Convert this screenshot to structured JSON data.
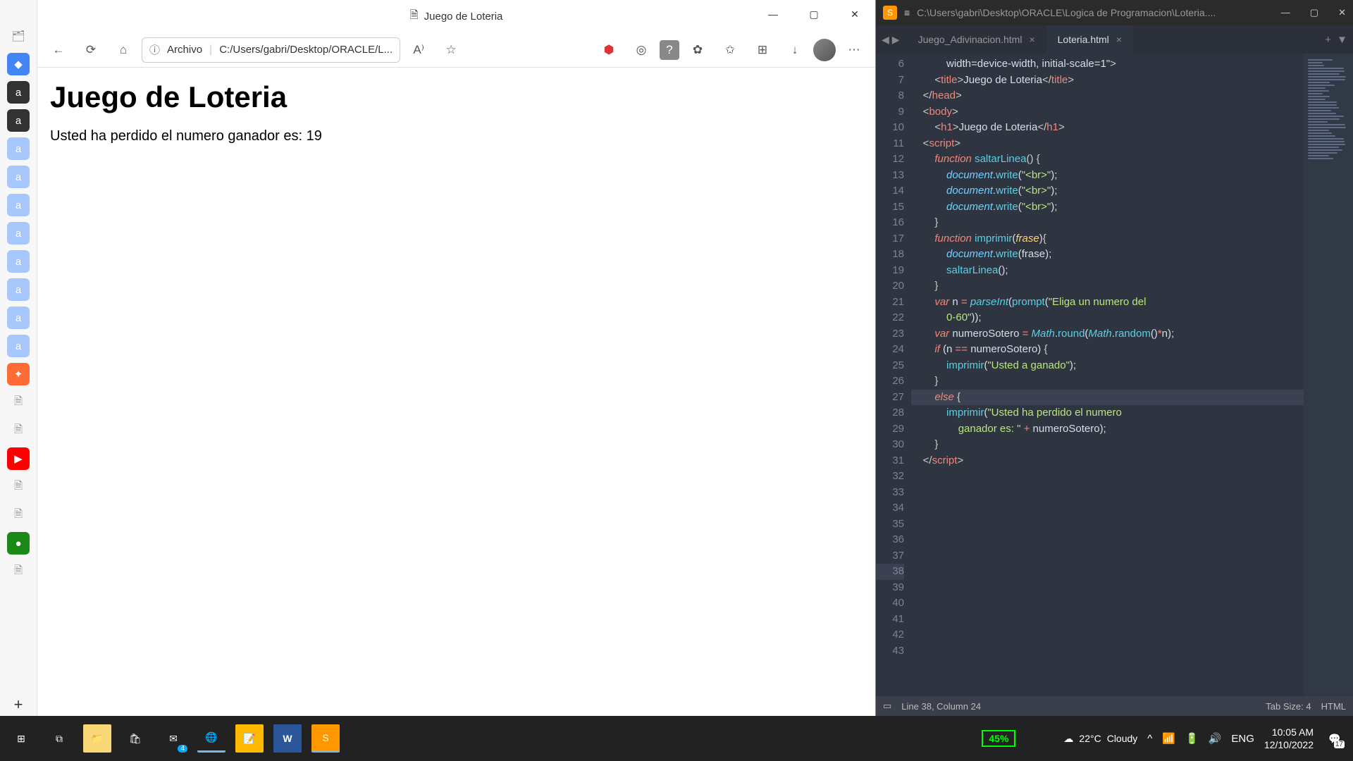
{
  "browser": {
    "title": "Juego de Loteria",
    "url_label": "Archivo",
    "url_path": "C:/Users/gabri/Desktop/ORACLE/L...",
    "page_heading": "Juego de Loteria",
    "page_text": "Usted ha perdido el numero ganador es: 19"
  },
  "sublime": {
    "title_path": "C:\\Users\\gabri\\Desktop\\ORACLE\\Logica de Programacion\\Loteria....",
    "tabs": [
      {
        "label": "Juego_Adivinacion.html",
        "active": false
      },
      {
        "label": "Loteria.html",
        "active": true
      }
    ],
    "gutter_start": 6,
    "gutter_end": 43,
    "highlight_line": 38,
    "status": {
      "position": "Line 38, Column 24",
      "tab_size": "Tab Size: 4",
      "syntax": "HTML"
    }
  },
  "taskbar": {
    "battery": "45%",
    "weather_temp": "22°C",
    "weather_text": "Cloudy",
    "lang": "ENG",
    "time": "10:05 AM",
    "date": "12/10/2022",
    "notif_count": "17",
    "mail_badge": "4"
  }
}
